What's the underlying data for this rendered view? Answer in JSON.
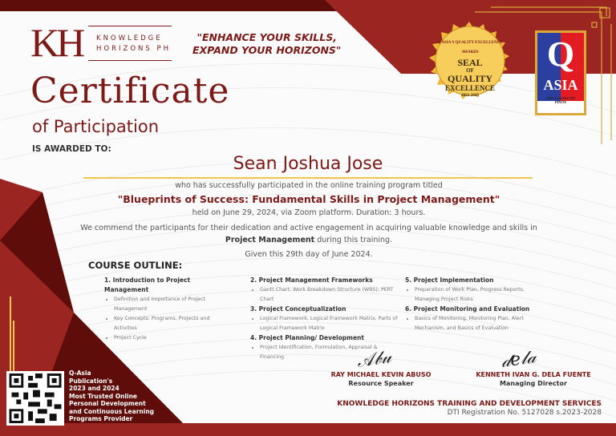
{
  "logo": {
    "mark": "KH",
    "line1": "KNOWLEDGE",
    "line2": "HORIZONS PH"
  },
  "tagline": {
    "line1": "\"ENHANCE YOUR SKILLS,",
    "line2": "EXPAND YOUR HORIZONS\""
  },
  "title": "Certificate",
  "subtitle": "of Participation",
  "awarded_to": "IS AWARDED TO:",
  "recipient": "Sean Joshua Jose",
  "body": {
    "line1": "who has successfully participated in the online training program titled",
    "program": "\"Blueprints of Success: Fundamental Skills in Project Management\"",
    "line3": "held on June 29, 2024, via Zoom platform. Duration: 3 hours.",
    "line4a": "We commend the participants for their dedication and active engagement in acquiring valuable knowledge and skills in ",
    "line4b": "Project Management",
    "line4c": " during this training.",
    "given": "Given this 29th day of June 2024."
  },
  "outline": {
    "heading": "COURSE OUTLINE:",
    "sections": [
      {
        "title": "1. Introduction to Project Management",
        "items": [
          "Definition and Importance of Project Management",
          "Key Concepts: Programs, Projects and Activities",
          "Project Cycle"
        ]
      },
      {
        "title": "2. Project Management Frameworks",
        "items": [
          "Gantt Chart; Work Breakdown Structure (WBS); PERT Chart"
        ]
      },
      {
        "title": "3. Project Conceptualization",
        "items": [
          "Logical Framework, Logical Framework Matrix, Parts of Logical Framework Matrix"
        ]
      },
      {
        "title": "4. Project Planning/ Development",
        "items": [
          "Project Identification, Formulation, Appraisal & Financing"
        ]
      },
      {
        "title": "5. Project Implementation",
        "items": [
          "Preparation of Work Plan, Progress Reports, Managing Project Risks"
        ]
      },
      {
        "title": "6. Project Monitoring and Evaluation",
        "items": [
          "Basics of Monitoring, Monitoring Plan, Alert Mechanism, and Basics of Evaluation"
        ]
      }
    ]
  },
  "seal": {
    "ring": "Q ASIA'S QUALITY EXCELLENCE AWARDS",
    "l1": "SEAL",
    "l2": "OF",
    "l3": "QUALITY",
    "l4": "EXCELLENCE",
    "years": "2022-2025"
  },
  "qasia_badge": {
    "big": "Q",
    "word": "ASIA",
    "motto": "ANG GALING NG PINOY"
  },
  "signatories": [
    {
      "name": "RAY MICHAEL KEVIN ABUSO",
      "role": "Resource Speaker"
    },
    {
      "name": "KENNETH IVAN G. DELA FUENTE",
      "role": "Managing Director"
    }
  ],
  "organization": {
    "name": "KNOWLEDGE HORIZONS TRAINING AND DEVELOPMENT SERVICES",
    "registration": "DTI Registration No. 5127028 s.2023-2028"
  },
  "qasia_award": [
    "Q-Asia",
    "Publication's",
    "2023 and 2024",
    "Most Trusted Online",
    "Personal Development",
    "and Continuous Learning",
    "Programs Provider"
  ],
  "colors": {
    "maroon": "#7b1a17",
    "dark": "#5e0d0a",
    "red": "#9b2521",
    "gold": "#f3c44f"
  }
}
